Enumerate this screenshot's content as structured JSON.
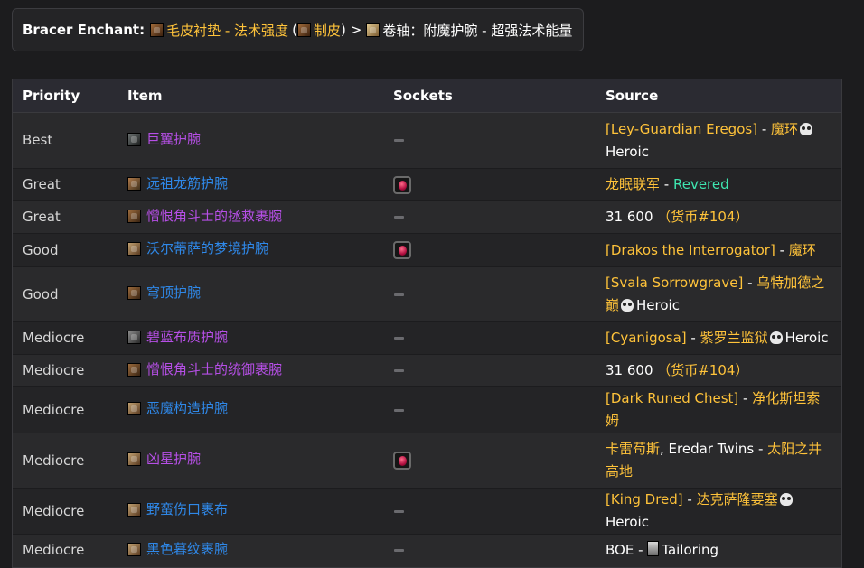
{
  "enchant": {
    "label": "Bracer Enchant:",
    "item_name": "毛皮衬垫 - 法术强度",
    "paren_open": "(",
    "profession": "制皮",
    "paren_close": ")",
    "arrow": ">",
    "scroll_name": "卷轴：附魔护腕 - 超强法术能量"
  },
  "table": {
    "headers": {
      "priority": "Priority",
      "item": "Item",
      "sockets": "Sockets",
      "source": "Source"
    },
    "rows": [
      {
        "priority": "Best",
        "item": "巨翼护腕",
        "quality": "epic",
        "icon": "ico-e",
        "socket": false,
        "source": [
          {
            "t": "[Ley-Guardian Eregos]",
            "c": "gold"
          },
          {
            "t": " - ",
            "c": "white"
          },
          {
            "t": "魔环",
            "c": "gold"
          },
          {
            "skull": true
          },
          {
            "t": "Heroic",
            "c": "white"
          }
        ]
      },
      {
        "priority": "Great",
        "item": "远祖龙筋护腕",
        "quality": "rare",
        "icon": "ico-c",
        "socket": true,
        "source": [
          {
            "t": "龙眠联军",
            "c": "gold"
          },
          {
            "t": " - ",
            "c": "white"
          },
          {
            "t": "Revered",
            "c": "rev"
          }
        ]
      },
      {
        "priority": "Great",
        "item": "憎恨角斗士的拯救裹腕",
        "quality": "epic",
        "icon": "ico-a",
        "socket": false,
        "source": [
          {
            "t": "31 600",
            "c": "white"
          },
          {
            "t": " （货币#104）",
            "c": "gold"
          }
        ]
      },
      {
        "priority": "Good",
        "item": "沃尔蒂萨的梦境护腕",
        "quality": "rare",
        "icon": "ico-b",
        "socket": true,
        "source": [
          {
            "t": "[Drakos the Interrogator]",
            "c": "gold"
          },
          {
            "t": " - ",
            "c": "white"
          },
          {
            "t": "魔环",
            "c": "gold"
          }
        ]
      },
      {
        "priority": "Good",
        "item": "穹顶护腕",
        "quality": "rare",
        "icon": "ico-a",
        "socket": false,
        "source": [
          {
            "t": "[Svala Sorrowgrave]",
            "c": "gold"
          },
          {
            "t": " - ",
            "c": "white"
          },
          {
            "t": "乌特加德之巅",
            "c": "gold"
          },
          {
            "skull": true
          },
          {
            "t": "Heroic",
            "c": "white"
          }
        ]
      },
      {
        "priority": "Mediocre",
        "item": "碧蓝布质护腕",
        "quality": "epic",
        "icon": "ico-d",
        "socket": false,
        "source": [
          {
            "t": "[Cyanigosa]",
            "c": "gold"
          },
          {
            "t": " - ",
            "c": "white"
          },
          {
            "t": "紫罗兰监狱",
            "c": "gold"
          },
          {
            "skull": true
          },
          {
            "t": "Heroic",
            "c": "white"
          }
        ]
      },
      {
        "priority": "Mediocre",
        "item": "憎恨角斗士的统御裹腕",
        "quality": "epic",
        "icon": "ico-a",
        "socket": false,
        "source": [
          {
            "t": "31 600",
            "c": "white"
          },
          {
            "t": " （货币#104）",
            "c": "gold"
          }
        ]
      },
      {
        "priority": "Mediocre",
        "item": "恶魔构造护腕",
        "quality": "rare",
        "icon": "ico-b",
        "socket": false,
        "source": [
          {
            "t": "[Dark Runed Chest]",
            "c": "gold"
          },
          {
            "t": " - ",
            "c": "white"
          },
          {
            "t": "净化斯坦索姆",
            "c": "gold"
          }
        ]
      },
      {
        "priority": "Mediocre",
        "item": "凶星护腕",
        "quality": "epic",
        "icon": "ico-b",
        "socket": true,
        "source": [
          {
            "t": "卡雷苟斯",
            "c": "gold"
          },
          {
            "t": ", Eredar Twins - ",
            "c": "white"
          },
          {
            "t": "太阳之井高地",
            "c": "gold"
          }
        ]
      },
      {
        "priority": "Mediocre",
        "item": "野蛮伤口裹布",
        "quality": "rare",
        "icon": "ico-b",
        "socket": false,
        "source": [
          {
            "t": "[King Dred]",
            "c": "gold"
          },
          {
            "t": " - ",
            "c": "white"
          },
          {
            "t": "达克萨隆要塞",
            "c": "gold"
          },
          {
            "skull": true
          },
          {
            "t": "Heroic",
            "c": "white"
          }
        ]
      },
      {
        "priority": "Mediocre",
        "item": "黑色暮纹裹腕",
        "quality": "rare",
        "icon": "ico-b",
        "socket": false,
        "source": [
          {
            "t": "BOE",
            "c": "white"
          },
          {
            "t": " - ",
            "c": "white"
          },
          {
            "tailor": true
          },
          {
            "t": "Tailoring",
            "c": "white"
          }
        ]
      }
    ]
  }
}
